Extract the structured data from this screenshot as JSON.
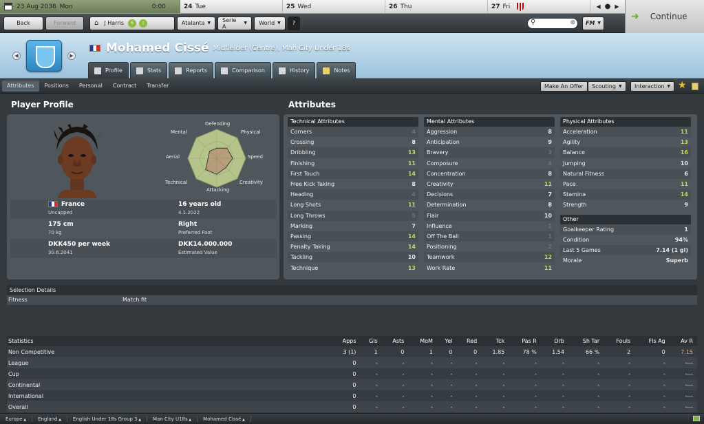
{
  "calendar": {
    "today_date": "23 Aug 2038",
    "today_weekday": "Mon",
    "time": "0:00",
    "days": [
      {
        "num": "24",
        "name": "Tue"
      },
      {
        "num": "25",
        "name": "Wed"
      },
      {
        "num": "26",
        "name": "Thu"
      },
      {
        "num": "27",
        "name": "Fri"
      }
    ]
  },
  "toolbar": {
    "back": "Back",
    "forward": "Forward",
    "manager": "J Harris",
    "mail_count": "6",
    "club": "Atalanta",
    "league": "Serie A",
    "world": "World",
    "help": "?",
    "fm": "FM",
    "continue": "Continue"
  },
  "player": {
    "name": "Mohamed Cissé",
    "role": "Midfielder (Centre), Man City Under 18s"
  },
  "tabs": [
    "Profile",
    "Stats",
    "Reports",
    "Comparison",
    "History",
    "Notes"
  ],
  "subnav": [
    "Attributes",
    "Positions",
    "Personal",
    "Contract",
    "Transfer"
  ],
  "actions": {
    "offer": "Make An Offer",
    "scouting": "Scouting",
    "interaction": "Interaction"
  },
  "profile": {
    "title": "Player Profile",
    "radar_labels": [
      "Defending",
      "Physical",
      "Speed",
      "Creativity",
      "Attacking",
      "Technical",
      "Aerial",
      "Mental"
    ],
    "nation": "France",
    "caps": "Uncapped",
    "age": "16 years old",
    "dob": "4.1.2022",
    "height": "175 cm",
    "weight": "70 kg",
    "foot": "Right",
    "foot_label": "Preferred Foot",
    "wage": "DKK450 per week",
    "contract": "30.6.2041",
    "value": "DKK14.000.000",
    "value_label": "Estimated Value"
  },
  "attributes": {
    "title": "Attributes",
    "technical": {
      "title": "Technical Attributes",
      "rows": [
        [
          "Corners",
          "4"
        ],
        [
          "Crossing",
          "8"
        ],
        [
          "Dribbling",
          "13"
        ],
        [
          "Finishing",
          "11"
        ],
        [
          "First Touch",
          "14"
        ],
        [
          "Free Kick Taking",
          "8"
        ],
        [
          "Heading",
          "4"
        ],
        [
          "Long Shots",
          "11"
        ],
        [
          "Long Throws",
          "5"
        ],
        [
          "Marking",
          "7"
        ],
        [
          "Passing",
          "14"
        ],
        [
          "Penalty Taking",
          "14"
        ],
        [
          "Tackling",
          "10"
        ],
        [
          "Technique",
          "13"
        ]
      ]
    },
    "mental": {
      "title": "Mental Attributes",
      "rows": [
        [
          "Aggression",
          "8"
        ],
        [
          "Anticipation",
          "9"
        ],
        [
          "Bravery",
          "3"
        ],
        [
          "Composure",
          "4"
        ],
        [
          "Concentration",
          "8"
        ],
        [
          "Creativity",
          "11"
        ],
        [
          "Decisions",
          "7"
        ],
        [
          "Determination",
          "8"
        ],
        [
          "Flair",
          "10"
        ],
        [
          "Influence",
          "1"
        ],
        [
          "Off The Ball",
          "1"
        ],
        [
          "Positioning",
          "2"
        ],
        [
          "Teamwork",
          "12"
        ],
        [
          "Work Rate",
          "11"
        ]
      ]
    },
    "physical": {
      "title": "Physical Attributes",
      "rows": [
        [
          "Acceleration",
          "11"
        ],
        [
          "Agility",
          "13"
        ],
        [
          "Balance",
          "16"
        ],
        [
          "Jumping",
          "10"
        ],
        [
          "Natural Fitness",
          "6"
        ],
        [
          "Pace",
          "11"
        ],
        [
          "Stamina",
          "14"
        ],
        [
          "Strength",
          "9"
        ]
      ]
    },
    "other": {
      "title": "Other",
      "rows": [
        [
          "Goalkeeper Rating",
          "1"
        ],
        [
          "Condition",
          "94%"
        ],
        [
          "Last 5 Games",
          "7.14 (1 gl)"
        ],
        [
          "Morale",
          "Superb"
        ]
      ]
    }
  },
  "selection": {
    "title": "Selection Details",
    "label": "Fitness",
    "value": "Match fit"
  },
  "stats": {
    "headers": [
      "Statistics",
      "Apps",
      "Gls",
      "Asts",
      "MoM",
      "Yel",
      "Red",
      "Tck",
      "Pas R",
      "Drb",
      "Sh Tar",
      "Fouls",
      "Fls Ag",
      "Av R"
    ],
    "rows": [
      [
        "Non Competitive",
        "3 (1)",
        "1",
        "0",
        "1",
        "0",
        "0",
        "1.85",
        "78 %",
        "1.54",
        "66 %",
        "2",
        "0",
        "7.15"
      ],
      [
        "League",
        "0",
        "-",
        "-",
        "-",
        "-",
        "-",
        "-",
        "-",
        "-",
        "-",
        "-",
        "-",
        "----"
      ],
      [
        "Cup",
        "0",
        "-",
        "-",
        "-",
        "-",
        "-",
        "-",
        "-",
        "-",
        "-",
        "-",
        "-",
        "----"
      ],
      [
        "Continental",
        "0",
        "-",
        "-",
        "-",
        "-",
        "-",
        "-",
        "-",
        "-",
        "-",
        "-",
        "-",
        "----"
      ],
      [
        "International",
        "0",
        "-",
        "-",
        "-",
        "-",
        "-",
        "-",
        "-",
        "-",
        "-",
        "-",
        "-",
        "----"
      ],
      [
        "Overall",
        "0",
        "-",
        "-",
        "-",
        "-",
        "-",
        "-",
        "-",
        "-",
        "-",
        "-",
        "-",
        "----"
      ]
    ]
  },
  "footer": [
    "Europe",
    "England",
    "English Under 18s Group 3",
    "Man City U18s",
    "Mohamed Cissé"
  ]
}
